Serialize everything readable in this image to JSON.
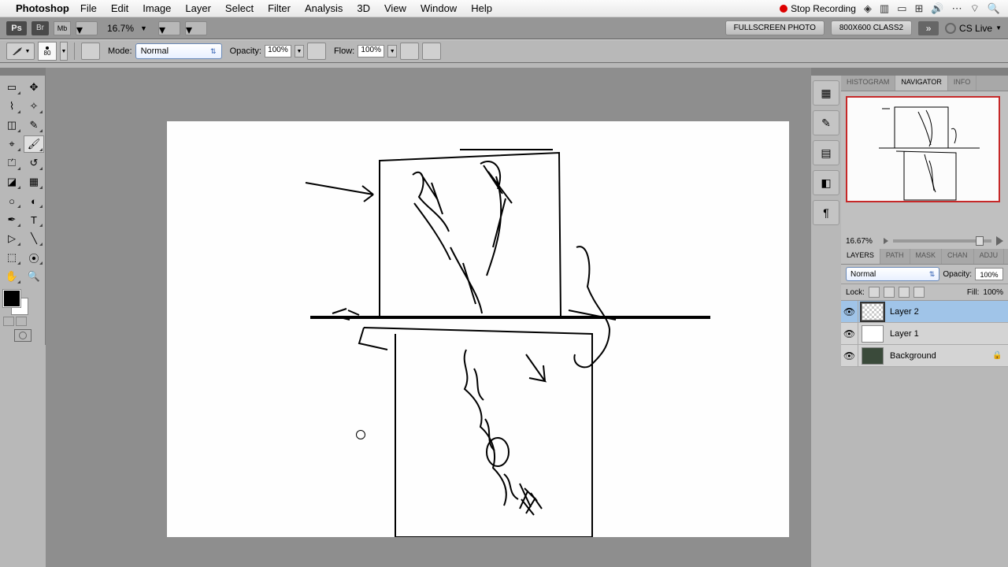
{
  "mac_menu": {
    "app": "Photoshop",
    "items": [
      "File",
      "Edit",
      "Image",
      "Layer",
      "Select",
      "Filter",
      "Analysis",
      "3D",
      "View",
      "Window",
      "Help"
    ],
    "record": "Stop Recording"
  },
  "infobar": {
    "zoom": "16.7%",
    "buttons": [
      "FULLSCREEN PHOTO",
      "800X600 CLASS2"
    ],
    "cs_live": "CS Live"
  },
  "options": {
    "brush_size": "80",
    "mode_label": "Mode:",
    "mode_value": "Normal",
    "opacity_label": "Opacity:",
    "opacity_value": "100%",
    "flow_label": "Flow:",
    "flow_value": "100%"
  },
  "navigator": {
    "tabs": [
      "HISTOGRAM",
      "NAVIGATOR",
      "INFO"
    ],
    "active_tab": 1,
    "zoom": "16.67%"
  },
  "layers": {
    "tabs": [
      "LAYERS",
      "PATH",
      "MASK",
      "CHAN",
      "ADJU"
    ],
    "active_tab": 0,
    "blend_mode": "Normal",
    "opacity_label": "Opacity:",
    "opacity": "100%",
    "lock_label": "Lock:",
    "fill_label": "Fill:",
    "fill": "100%",
    "rows": [
      {
        "name": "Layer 2",
        "selected": true,
        "thumb": "checker",
        "locked": false
      },
      {
        "name": "Layer 1",
        "selected": false,
        "thumb": "white",
        "locked": false
      },
      {
        "name": "Background",
        "selected": false,
        "thumb": "dark",
        "locked": true
      }
    ]
  }
}
